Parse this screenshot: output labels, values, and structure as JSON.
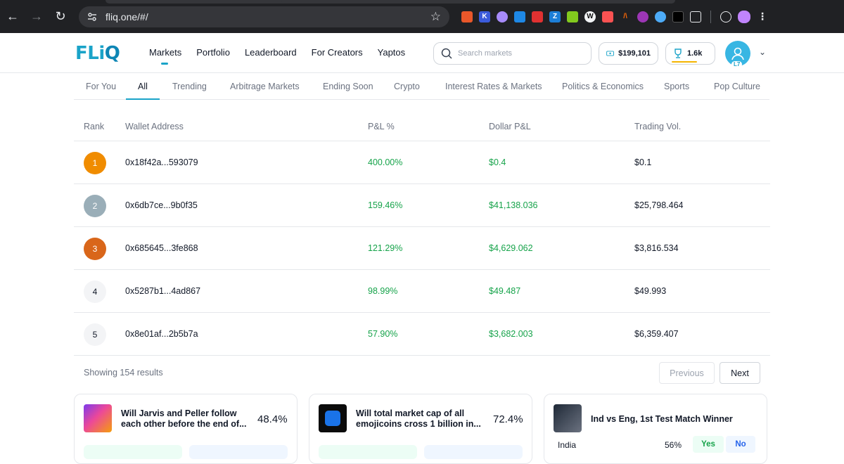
{
  "browser": {
    "url": "fliq.one/#/"
  },
  "header": {
    "logo": "FLiQ",
    "nav": [
      "Markets",
      "Portfolio",
      "Leaderboard",
      "For Creators",
      "Yaptos"
    ],
    "active_nav": "Markets",
    "search_placeholder": "Search markets",
    "balance": "$199,101",
    "trophy_count": "1.6k",
    "user_level": "L7"
  },
  "categories": {
    "tabs": [
      "For You",
      "All",
      "Trending",
      "Arbitrage Markets",
      "Ending Soon",
      "Crypto",
      "Interest Rates & Markets",
      "Politics & Economics",
      "Sports",
      "Pop Culture"
    ],
    "active": "All"
  },
  "leaderboard": {
    "headers": {
      "rank": "Rank",
      "wallet": "Wallet Address",
      "pnl_pct": "P&L %",
      "dollar_pnl": "Dollar P&L",
      "volume": "Trading Vol."
    },
    "rows": [
      {
        "rank": "1",
        "wallet": "0x18f42a...593079",
        "pnl_pct": "400.00%",
        "dollar_pnl": "$0.4",
        "volume": "$0.1",
        "badge_color": "#f08c00"
      },
      {
        "rank": "2",
        "wallet": "0x6db7ce...9b0f35",
        "pnl_pct": "159.46%",
        "dollar_pnl": "$41,138.036",
        "volume": "$25,798.464",
        "badge_color": "#9aaeb8"
      },
      {
        "rank": "3",
        "wallet": "0x685645...3fe868",
        "pnl_pct": "121.29%",
        "dollar_pnl": "$4,629.062",
        "volume": "$3,816.534",
        "badge_color": "#d9661a"
      },
      {
        "rank": "4",
        "wallet": "0x5287b1...4ad867",
        "pnl_pct": "98.99%",
        "dollar_pnl": "$49.487",
        "volume": "$49.993",
        "badge_color": "#f3f4f6"
      },
      {
        "rank": "5",
        "wallet": "0x8e01af...2b5b7a",
        "pnl_pct": "57.90%",
        "dollar_pnl": "$3,682.003",
        "volume": "$6,359.407",
        "badge_color": "#f3f4f6"
      }
    ]
  },
  "pagination": {
    "results_text": "Showing 154 results",
    "prev": "Previous",
    "next": "Next"
  },
  "cards": [
    {
      "question": "Will Jarvis and Peller follow each other before the end of...",
      "percent": "48.4%"
    },
    {
      "question": "Will total market cap of all emojicoins cross 1 billion in...",
      "percent": "72.4%"
    },
    {
      "question": "Ind vs Eng, 1st Test Match Winner",
      "option": "India",
      "option_pct": "56%",
      "yes": "Yes",
      "no": "No"
    }
  ]
}
